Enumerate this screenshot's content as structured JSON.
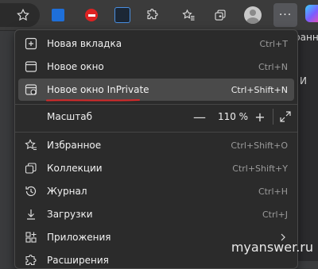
{
  "toolbar": {
    "icons": [
      "favorite-star-icon",
      "css-extension-icon",
      "block-extension-icon",
      "dark-extension-icon",
      "puzzle-extensions-icon",
      "favorites-icon",
      "collections-icon",
      "profile-avatar",
      "more-menu-icon"
    ],
    "more_label": "···"
  },
  "background_page": {
    "text1": "ранн",
    "text2": "И"
  },
  "menu": {
    "items": [
      {
        "label": "Новая вкладка",
        "shortcut": "Ctrl+T",
        "icon": "new-tab-icon"
      },
      {
        "label": "Новое окно",
        "shortcut": "Ctrl+N",
        "icon": "new-window-icon"
      },
      {
        "label": "Новое окно InPrivate",
        "shortcut": "Ctrl+Shift+N",
        "icon": "inprivate-window-icon"
      }
    ],
    "zoom": {
      "label": "Масштаб",
      "value": "110 %",
      "minus": "—",
      "plus": "+"
    },
    "items2": [
      {
        "label": "Избранное",
        "shortcut": "Ctrl+Shift+O",
        "icon": "favorites-icon"
      },
      {
        "label": "Коллекции",
        "shortcut": "Ctrl+Shift+Y",
        "icon": "collections-icon"
      },
      {
        "label": "Журнал",
        "shortcut": "Ctrl+H",
        "icon": "history-icon"
      },
      {
        "label": "Загрузки",
        "shortcut": "Ctrl+J",
        "icon": "downloads-icon"
      },
      {
        "label": "Приложения",
        "shortcut": "",
        "icon": "apps-icon"
      },
      {
        "label": "Расширения",
        "shortcut": "",
        "icon": "extensions-icon"
      }
    ]
  },
  "watermark": "myanswer.ru",
  "colors": {
    "underline": "#d62a2a",
    "menu_bg": "#2b2b2b",
    "highlight": "#4a4a4a"
  }
}
